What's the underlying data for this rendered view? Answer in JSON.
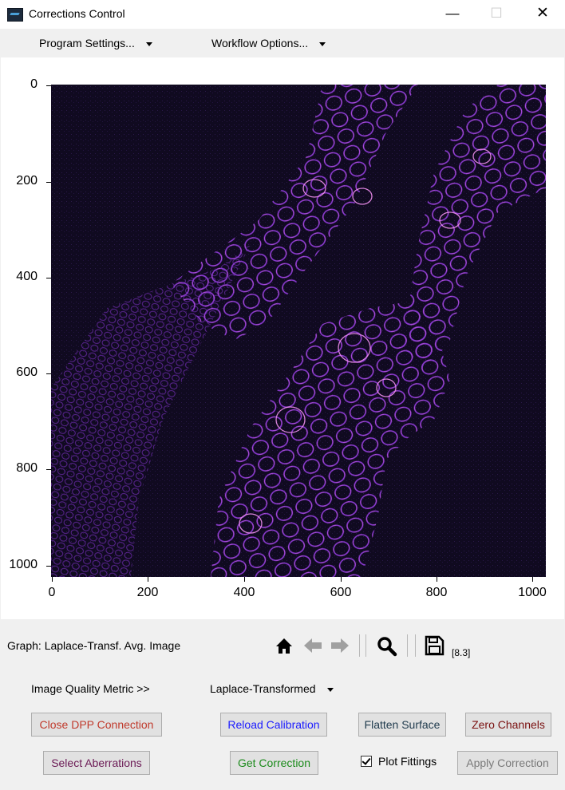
{
  "window": {
    "title": "Corrections Control",
    "minimize_glyph": "—",
    "maximize_glyph": "☐",
    "close_glyph": "✕"
  },
  "menubar": {
    "program_settings": "Program Settings...",
    "workflow_options": "Workflow Options..."
  },
  "plot": {
    "image_description_colormap": "magma",
    "x_ticks": [
      "0",
      "200",
      "400",
      "600",
      "800",
      "1000"
    ],
    "y_ticks": [
      "0",
      "200",
      "400",
      "600",
      "800",
      "1000"
    ],
    "xlim": [
      0,
      1024
    ],
    "ylim": [
      1024,
      0
    ]
  },
  "graph_label": "Graph: Laplace-Transf. Avg. Image",
  "toolbar": {
    "home_icon": "home-icon",
    "back_icon": "arrow-left-icon",
    "forward_icon": "arrow-right-icon",
    "zoom_icon": "magnifier-icon",
    "save_icon": "floppy-disk-icon",
    "coordinate_readout": "[8.3]"
  },
  "metric": {
    "label": "Image Quality Metric  >>",
    "selected": "Laplace-Transformed"
  },
  "buttons": {
    "close_dpp": "Close DPP Connection",
    "reload_calibration": "Reload Calibration",
    "flatten_surface": "Flatten Surface",
    "zero_channels": "Zero Channels",
    "select_aberrations": "Select Aberrations",
    "get_correction": "Get Correction",
    "apply_correction": "Apply Correction"
  },
  "plot_fittings": {
    "label": "Plot Fittings",
    "checked": true
  },
  "colors": {
    "close_dpp": "#c0392b",
    "reload_calibration": "#1a1aff",
    "flatten_surface": "#1f3a4d",
    "zero_channels": "#7a1010",
    "select_aberrations": "#6b1a55",
    "get_correction": "#1a8a1a",
    "apply_correction_disabled": "#7a7a7a",
    "image_bg": "#100a20",
    "cell_wall": "#8a3ad0",
    "cell_wall_bright": "#e070e0"
  }
}
